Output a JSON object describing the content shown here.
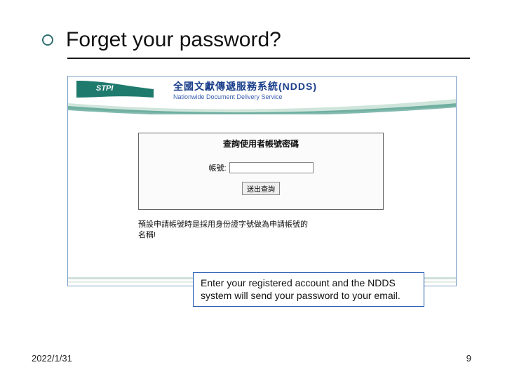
{
  "slide": {
    "title": "Forget your password?",
    "date": "2022/1/31",
    "page": "9"
  },
  "banner": {
    "logo_text": "STPI",
    "title_zh": "全國文獻傳遞服務系統(NDDS)",
    "title_en": "Nationwide Document Delivery Service"
  },
  "form": {
    "heading": "查詢使用者帳號密碼",
    "field_label": "帳號:",
    "submit_label": "送出查詢"
  },
  "note": {
    "line1": "預設申請帳號時是採用身份證字號做為申請帳號的",
    "line2": "名稱!"
  },
  "callout": "Enter your registered account and the NDDS system will send your password to your email."
}
